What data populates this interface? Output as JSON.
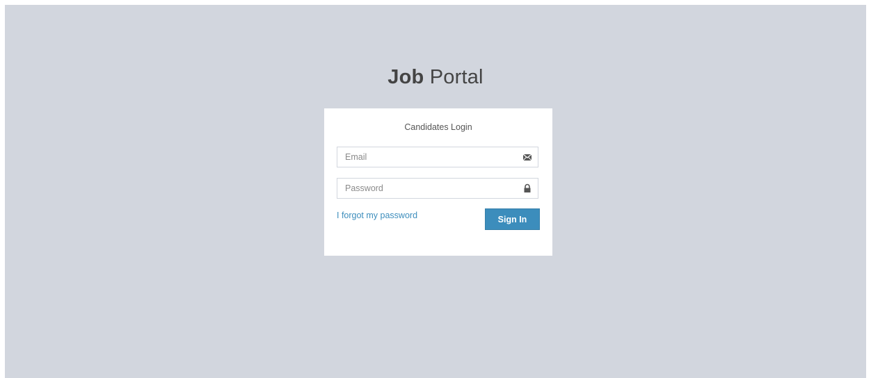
{
  "logo": {
    "strong": "Job",
    "light": "Portal"
  },
  "login_box": {
    "title": "Candidates Login",
    "email": {
      "placeholder": "Email",
      "value": "",
      "icon": "envelope-icon"
    },
    "password": {
      "placeholder": "Password",
      "value": "",
      "icon": "lock-icon"
    },
    "forgot_link": "I forgot my password",
    "sign_in_label": "Sign In"
  },
  "colors": {
    "background": "#d2d6de",
    "card": "#ffffff",
    "accent": "#3c8dbc",
    "text": "#444444"
  }
}
